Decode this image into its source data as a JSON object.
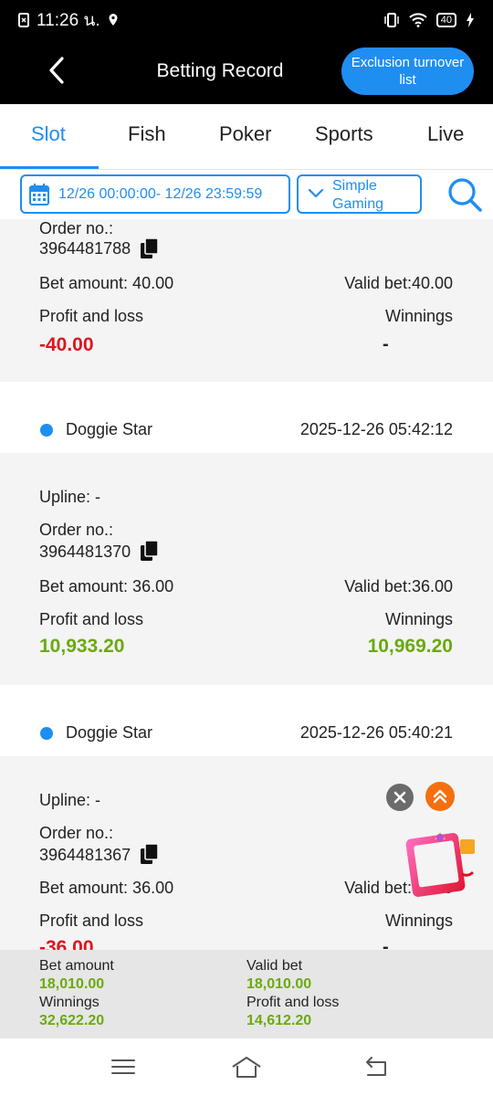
{
  "status_bar": {
    "time": "11:26 น.",
    "battery": "40"
  },
  "header": {
    "title": "Betting Record",
    "exclusion_button": "Exclusion turnover list"
  },
  "tabs": [
    "Slot",
    "Fish",
    "Poker",
    "Sports",
    "Live"
  ],
  "active_tab": "Slot",
  "filters": {
    "date_range": "12/26 00:00:00- 12/26 23:59:59",
    "game_provider": "Simple Gaming"
  },
  "records": [
    {
      "order_label": "Order no.:",
      "order_no": "3964481788",
      "bet_amount": "Bet amount: 40.00",
      "valid_bet": "Valid bet:40.00",
      "profit_label": "Profit and loss",
      "profit": "-40.00",
      "winnings_label": "Winnings",
      "winnings": "-"
    },
    {
      "game": "Doggie Star",
      "time": "2025-12-26 05:42:12",
      "upline": "Upline: -",
      "order_label": "Order no.:",
      "order_no": "3964481370",
      "bet_amount": "Bet amount: 36.00",
      "valid_bet": "Valid bet:36.00",
      "profit_label": "Profit and loss",
      "profit": "10,933.20",
      "winnings_label": "Winnings",
      "winnings": "10,969.20"
    },
    {
      "game": "Doggie Star",
      "time": "2025-12-26 05:40:21",
      "upline": "Upline: -",
      "order_label": "Order no.:",
      "order_no": "3964481367",
      "bet_amount": "Bet amount: 36.00",
      "valid_bet": "Valid bet:36.00",
      "profit_label": "Profit and loss",
      "profit": "-36.00",
      "winnings_label": "Winnings",
      "winnings": "-"
    }
  ],
  "summary": {
    "bet_amount_label": "Bet amount",
    "bet_amount": "18,010.00",
    "valid_bet_label": "Valid bet",
    "valid_bet": "18,010.00",
    "winnings_label": "Winnings",
    "winnings": "32,622.20",
    "profit_label": "Profit and loss",
    "profit": "14,612.20"
  },
  "icons": {
    "back": "chevron-left-icon",
    "calendar": "calendar-icon",
    "dropdown": "chevron-down-icon",
    "search": "search-icon",
    "copy": "copy-icon",
    "close": "close-icon",
    "scroll_top": "double-chevron-up-icon",
    "promo": "gift-box-icon"
  },
  "colors": {
    "accent": "#1f8ef1",
    "negative": "#e0141e",
    "positive": "#6aaa10",
    "scroll_top": "#f36f10"
  }
}
